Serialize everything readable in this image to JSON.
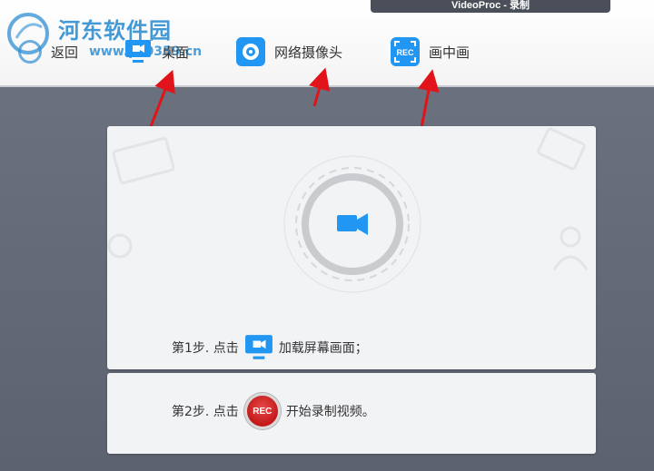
{
  "window": {
    "title": "VideoProc - 录制"
  },
  "watermark": {
    "site_name": "河东软件园",
    "url": "www.pc0359.cn"
  },
  "toolbar": {
    "back_label": "返回",
    "desktop_label": "桌面",
    "webcam_label": "网络摄像头",
    "pip_label": "画中画",
    "pip_icon_text": "REC"
  },
  "steps": {
    "step1_prefix": "第1步. 点击",
    "step1_suffix": "加载屏幕画面；",
    "step2_prefix": "第2步. 点击",
    "step2_rec": "REC",
    "step2_suffix": "开始录制视频。"
  },
  "colors": {
    "accent": "#2f8fd3",
    "icon_blue": "#2196f3",
    "arrow_red": "#e0141a",
    "rec_red": "#c31818"
  },
  "icons": {
    "desktop": "monitor-icon",
    "webcam": "webcam-icon",
    "pip": "rec-icon",
    "center": "video-camera-icon"
  }
}
